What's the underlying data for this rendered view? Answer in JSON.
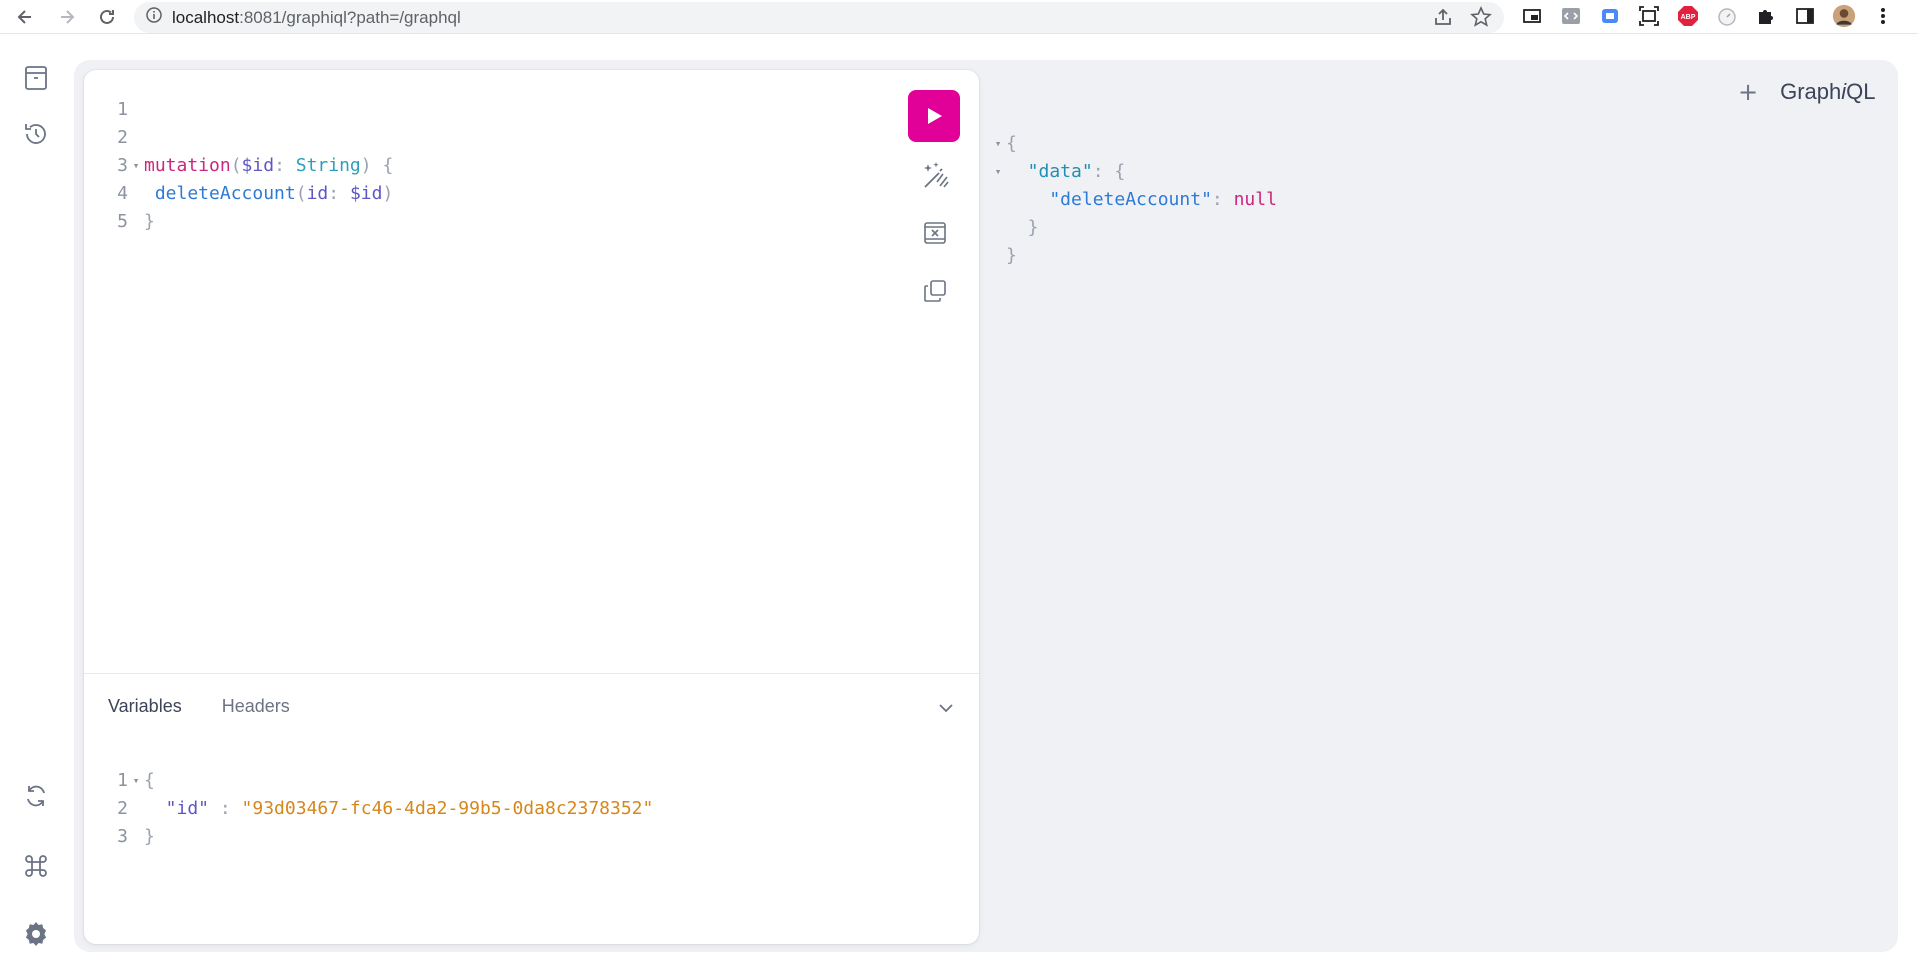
{
  "browser": {
    "url_host": "localhost",
    "url_rest": ":8081/graphiql?path=/graphql",
    "ext_abp": "ABP"
  },
  "app": {
    "logo": "GraphiQL",
    "plus": "+"
  },
  "query": {
    "lines": [
      {
        "n": "1",
        "fold": "",
        "tokens": []
      },
      {
        "n": "2",
        "fold": "",
        "tokens": []
      },
      {
        "n": "3",
        "fold": "▾",
        "tokens": [
          {
            "t": "mutation",
            "c": "kw"
          },
          {
            "t": "(",
            "c": "punc"
          },
          {
            "t": "$id",
            "c": "var"
          },
          {
            "t": ": ",
            "c": "punc"
          },
          {
            "t": "String",
            "c": "type"
          },
          {
            "t": ") {",
            "c": "punc"
          }
        ]
      },
      {
        "n": "4",
        "fold": "",
        "tokens": [
          {
            "t": " deleteAccount",
            "c": "field"
          },
          {
            "t": "(",
            "c": "punc"
          },
          {
            "t": "id",
            "c": "var"
          },
          {
            "t": ": ",
            "c": "punc"
          },
          {
            "t": "$id",
            "c": "var"
          },
          {
            "t": ")",
            "c": "punc"
          }
        ]
      },
      {
        "n": "5",
        "fold": "",
        "tokens": [
          {
            "t": "}",
            "c": "punc"
          }
        ]
      }
    ]
  },
  "variables_panel": {
    "tabs": [
      "Variables",
      "Headers"
    ],
    "lines": [
      {
        "n": "1",
        "fold": "▾",
        "tokens": [
          {
            "t": "{",
            "c": "punc"
          }
        ]
      },
      {
        "n": "2",
        "fold": "",
        "tokens": [
          {
            "t": "  \"id\"",
            "c": "var"
          },
          {
            "t": " : ",
            "c": "punc"
          },
          {
            "t": "\"93d03467-fc46-4da2-99b5-0da8c2378352\"",
            "c": "str"
          }
        ]
      },
      {
        "n": "3",
        "fold": "",
        "tokens": [
          {
            "t": "}",
            "c": "punc"
          }
        ]
      }
    ]
  },
  "result": {
    "lines": [
      {
        "fold": "▾",
        "tokens": [
          {
            "t": "{",
            "c": "punc"
          }
        ]
      },
      {
        "fold": "▾",
        "tokens": [
          {
            "t": "  \"data\"",
            "c": "prop-b"
          },
          {
            "t": ": {",
            "c": "punc"
          }
        ]
      },
      {
        "fold": "",
        "tokens": [
          {
            "t": "    \"deleteAccount\"",
            "c": "field"
          },
          {
            "t": ": ",
            "c": "punc"
          },
          {
            "t": "null",
            "c": "null"
          }
        ]
      },
      {
        "fold": "",
        "tokens": [
          {
            "t": "  }",
            "c": "punc"
          }
        ]
      },
      {
        "fold": "",
        "tokens": [
          {
            "t": "}",
            "c": "punc"
          }
        ]
      }
    ]
  },
  "colors": {
    "accent": "#e10098"
  }
}
